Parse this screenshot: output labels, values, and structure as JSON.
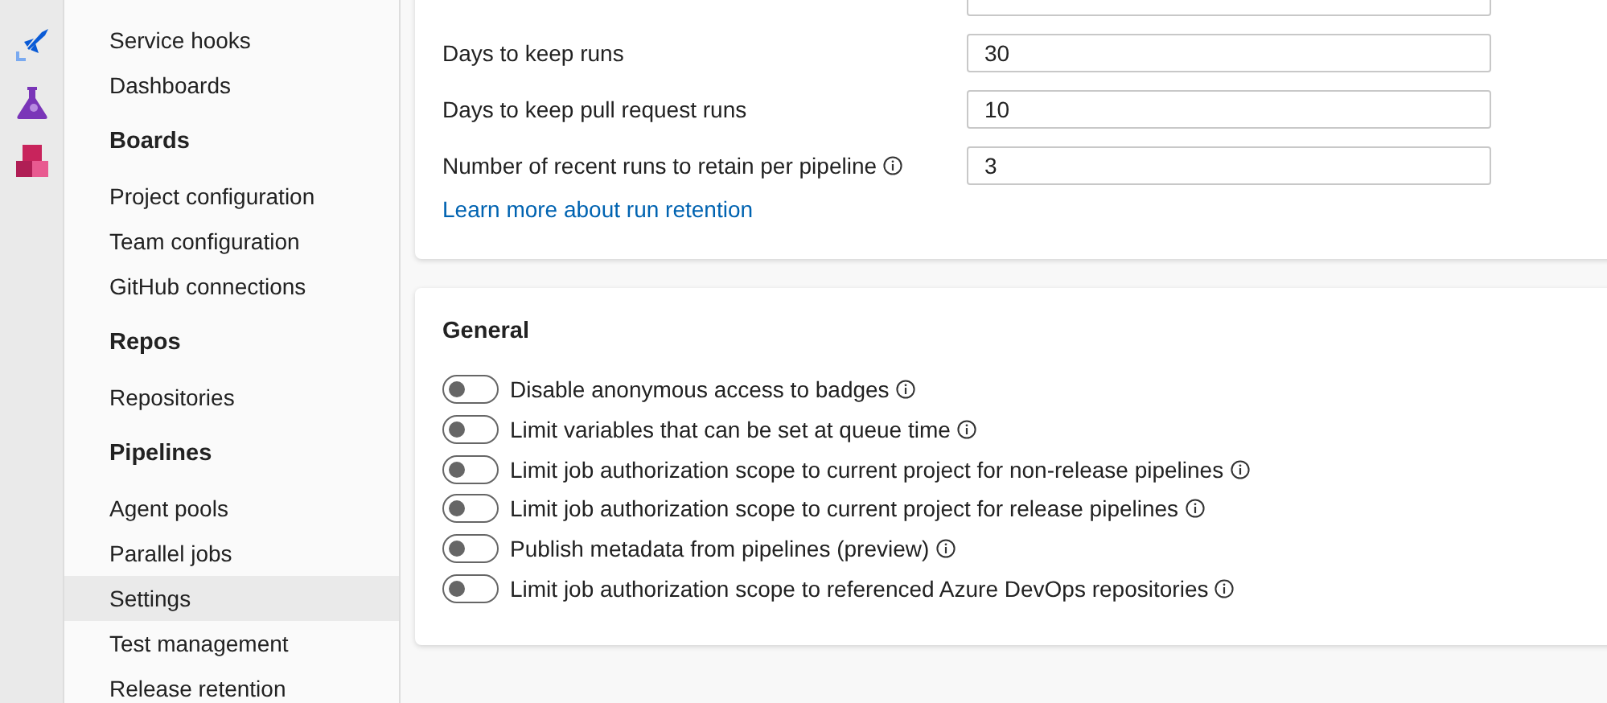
{
  "sidebar": {
    "sections": [
      {
        "items": [
          {
            "label": "Service hooks",
            "selected": false
          },
          {
            "label": "Dashboards",
            "selected": false
          }
        ]
      },
      {
        "heading": "Boards",
        "items": [
          {
            "label": "Project configuration",
            "selected": false
          },
          {
            "label": "Team configuration",
            "selected": false
          },
          {
            "label": "GitHub connections",
            "selected": false
          }
        ]
      },
      {
        "heading": "Repos",
        "items": [
          {
            "label": "Repositories",
            "selected": false
          }
        ]
      },
      {
        "heading": "Pipelines",
        "items": [
          {
            "label": "Agent pools",
            "selected": false
          },
          {
            "label": "Parallel jobs",
            "selected": false
          },
          {
            "label": "Settings",
            "selected": true
          },
          {
            "label": "Test management",
            "selected": false
          },
          {
            "label": "Release retention",
            "selected": false
          }
        ]
      }
    ]
  },
  "retention": {
    "fields": [
      {
        "label": "Days to keep runs",
        "value": "30",
        "info": false
      },
      {
        "label": "Days to keep pull request runs",
        "value": "10",
        "info": false
      },
      {
        "label": "Number of recent runs to retain per pipeline",
        "value": "3",
        "info": true
      }
    ],
    "link": "Learn more about run retention"
  },
  "general": {
    "title": "General",
    "toggles": [
      {
        "label": "Disable anonymous access to badges",
        "on": false
      },
      {
        "label": "Limit variables that can be set at queue time",
        "on": false
      },
      {
        "label": "Limit job authorization scope to current project for non-release pipelines",
        "on": false
      },
      {
        "label": "Limit job authorization scope to current project for release pipelines",
        "on": false
      },
      {
        "label": "Publish metadata from pipelines (preview)",
        "on": false
      },
      {
        "label": "Limit job authorization scope to referenced Azure DevOps repositories",
        "on": false
      }
    ]
  }
}
